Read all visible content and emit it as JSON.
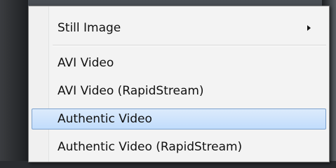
{
  "menu": {
    "items": [
      {
        "label": "Still Image",
        "submenu_icon": "chevron-right-icon"
      },
      {
        "label": "AVI Video"
      },
      {
        "label": "AVI Video (RapidStream)"
      },
      {
        "label": "Authentic Video",
        "highlighted": true
      },
      {
        "label": "Authentic Video (RapidStream)"
      }
    ]
  },
  "colors": {
    "highlight": "#c1dcfc",
    "highlight_border": "#7da2ce",
    "menu_bg": "#f3f3f3"
  }
}
